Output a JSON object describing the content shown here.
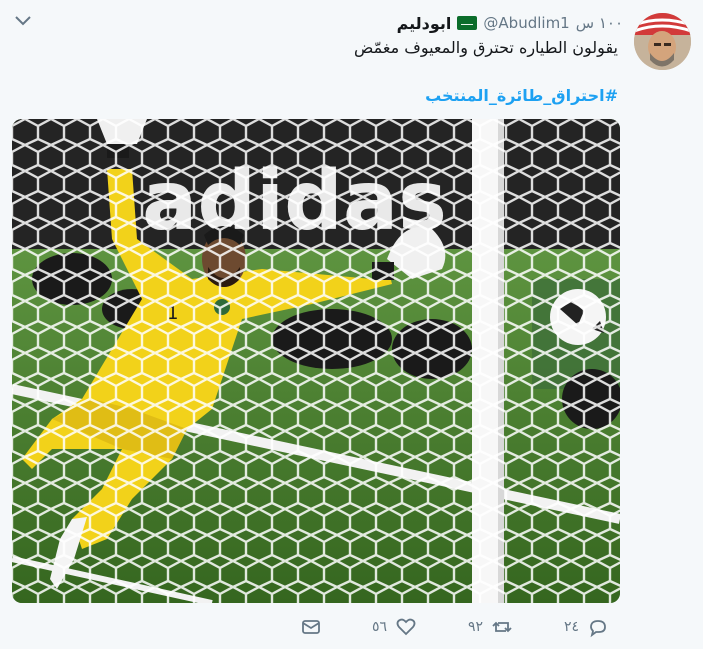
{
  "tweet": {
    "author_name": "ابودليم",
    "handle": "@Abudlim1",
    "time": "١٠٠ س",
    "text": "يقولون الطياره تحترق والمعيوف مغمّض",
    "hashtag": "#احتراق_طائرة_المنتخب",
    "avatar_icon": "user-avatar",
    "flag_icon": "saudi-flag-icon",
    "media_text": "adidas",
    "goalkeeper_number": "1"
  },
  "actions": {
    "reply_count": "٢٤",
    "retweet_count": "٩٢",
    "like_count": "٥٦"
  },
  "colors": {
    "background": "#f5f8fa",
    "text": "#14171a",
    "secondary": "#657786",
    "link": "#1da1f2"
  }
}
